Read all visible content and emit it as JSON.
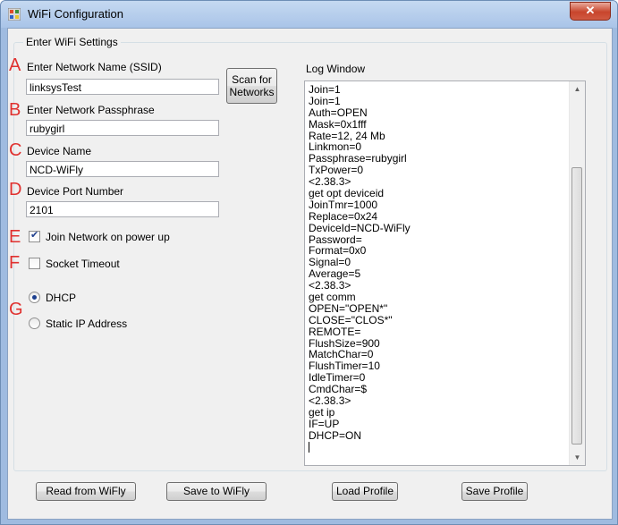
{
  "window": {
    "title": "WiFi Configuration",
    "close_glyph": "✕"
  },
  "group_title": "Enter WiFi Settings",
  "markers": [
    "A",
    "B",
    "C",
    "D",
    "E",
    "F",
    "G"
  ],
  "fields": {
    "ssid": {
      "label": "Enter Network Name (SSID)",
      "value": "linksysTest"
    },
    "passphrase": {
      "label": "Enter Network Passphrase",
      "value": "rubygirl"
    },
    "device_name": {
      "label": "Device Name",
      "value": "NCD-WiFly"
    },
    "device_port": {
      "label": "Device Port Number",
      "value": "2101"
    }
  },
  "scan_button": {
    "line1": "Scan for",
    "line2": "Networks"
  },
  "join_checkbox": {
    "label": "Join Network on power up",
    "checked": true
  },
  "socket_checkbox": {
    "label": "Socket Timeout",
    "checked": false
  },
  "dhcp_radio": {
    "label": "DHCP",
    "selected": true
  },
  "static_radio": {
    "label": "Static IP Address",
    "selected": false
  },
  "log_title": "Log Window",
  "log_lines": [
    "Join=1",
    "Join=1",
    "Auth=OPEN",
    "Mask=0x1fff",
    "Rate=12, 24 Mb",
    "Linkmon=0",
    "Passphrase=rubygirl",
    "TxPower=0",
    "<2.38.3>",
    "get opt deviceid",
    "JoinTmr=1000",
    "Replace=0x24",
    "DeviceId=NCD-WiFly",
    "Password=",
    "Format=0x0",
    "Signal=0",
    "Average=5",
    "<2.38.3>",
    "get comm",
    "OPEN=\"OPEN*\"",
    "CLOSE=\"CLOS*\"",
    "REMOTE=",
    "FlushSize=900",
    "MatchChar=0",
    "FlushTimer=10",
    "IdleTimer=0",
    "CmdChar=$",
    "<2.38.3>",
    "get ip",
    "IF=UP",
    "DHCP=ON"
  ],
  "buttons": {
    "read": "Read from WiFly",
    "save": "Save to WiFly",
    "load_profile": "Load Profile",
    "save_profile": "Save Profile"
  },
  "colors": {
    "marker": "#e0312f",
    "title_bar": "#b7cfee",
    "close": "#c8452c"
  }
}
